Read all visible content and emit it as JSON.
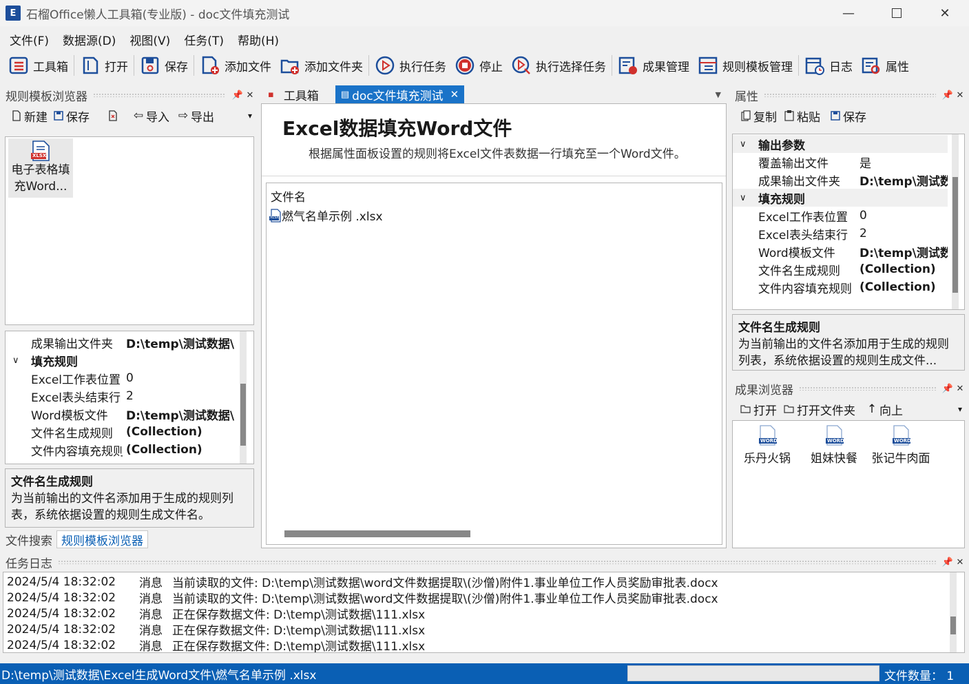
{
  "window": {
    "title": "石榴Office懒人工具箱(专业版) - doc文件填充测试",
    "app_icon": "E"
  },
  "menu": [
    "文件(F)",
    "数据源(D)",
    "视图(V)",
    "任务(T)",
    "帮助(H)"
  ],
  "toolbar": {
    "toolbox": "工具箱",
    "open": "打开",
    "save": "保存",
    "add_file": "添加文件",
    "add_folder": "添加文件夹",
    "run_task": "执行任务",
    "stop": "停止",
    "run_selected": "执行选择任务",
    "results": "成果管理",
    "rule_templates": "规则模板管理",
    "log": "日志",
    "properties": "属性"
  },
  "left_panel": {
    "title": "规则模板浏览器",
    "toolbar": {
      "new": "新建",
      "save": "保存",
      "import": "导入",
      "export": "导出"
    },
    "template_item": {
      "line1": "电子表格填",
      "line2": "充Word...",
      "badge": "XLSX"
    },
    "props": [
      {
        "key": "成果输出文件夹",
        "value": "D:\\temp\\测试数据\\"
      },
      {
        "key": "填充规则",
        "value": ""
      },
      {
        "key": "Excel工作表位置",
        "value": "0"
      },
      {
        "key": "Excel表头结束行",
        "value": "2"
      },
      {
        "key": "Word模板文件",
        "value": "D:\\temp\\测试数据\\"
      },
      {
        "key": "文件名生成规则",
        "value": "(Collection)"
      },
      {
        "key": "文件内容填充规则",
        "value": "(Collection)"
      }
    ],
    "desc_title": "文件名生成规则",
    "desc_text": "为当前输出的文件名添加用于生成的规则列表，系统依据设置的规则生成文件名。",
    "tabs": [
      "文件搜索",
      "规则模板浏览器"
    ]
  },
  "center": {
    "tabs": [
      "工具箱",
      "doc文件填充测试"
    ],
    "heading": "Excel数据填充Word文件",
    "subheading": "根据属性面板设置的规则将Excel文件表数据一行填充至一个Word文件。",
    "list_header": "文件名",
    "files": [
      {
        "name": "燃气名单示例 .xlsx",
        "badge": "XLSX"
      }
    ]
  },
  "right_props": {
    "title": "属性",
    "toolbar": {
      "copy": "复制",
      "paste": "粘贴",
      "save": "保存"
    },
    "groups": [
      {
        "name": "输出参数",
        "rows": [
          {
            "key": "覆盖输出文件",
            "value": "是"
          },
          {
            "key": "成果输出文件夹",
            "value": "D:\\temp\\测试数据"
          }
        ]
      },
      {
        "name": "填充规则",
        "rows": [
          {
            "key": "Excel工作表位置",
            "value": "0"
          },
          {
            "key": "Excel表头结束行",
            "value": "2"
          },
          {
            "key": "Word模板文件",
            "value": "D:\\temp\\测试数据"
          },
          {
            "key": "文件名生成规则",
            "value": "(Collection)"
          },
          {
            "key": "文件内容填充规则",
            "value": "(Collection)"
          }
        ]
      }
    ],
    "desc_title": "文件名生成规则",
    "desc_text": "为当前输出的文件名添加用于生成的规则列表，系统依据设置的规则生成文件..."
  },
  "results": {
    "title": "成果浏览器",
    "toolbar": {
      "open": "打开",
      "open_folder": "打开文件夹",
      "up": "向上"
    },
    "badge": "WORD",
    "files": [
      "乐丹火锅",
      "姐妹快餐",
      "张记牛肉面"
    ]
  },
  "log": {
    "title": "任务日志",
    "lines": [
      {
        "time": "2024/5/4 18:32:02",
        "level": "消息",
        "text": "当前读取的文件:  D:\\temp\\测试数据\\word文件数据提取\\(沙僧)附件1.事业单位工作人员奖励审批表.docx"
      },
      {
        "time": "2024/5/4 18:32:02",
        "level": "消息",
        "text": "当前读取的文件:  D:\\temp\\测试数据\\word文件数据提取\\(沙僧)附件1.事业单位工作人员奖励审批表.docx"
      },
      {
        "time": "2024/5/4 18:32:02",
        "level": "消息",
        "text": "正在保存数据文件:  D:\\temp\\测试数据\\111.xlsx"
      },
      {
        "time": "2024/5/4 18:32:02",
        "level": "消息",
        "text": "正在保存数据文件:  D:\\temp\\测试数据\\111.xlsx"
      },
      {
        "time": "2024/5/4 18:32:02",
        "level": "消息",
        "text": "正在保存数据文件:  D:\\temp\\测试数据\\111.xlsx"
      }
    ]
  },
  "status": {
    "path": "D:\\temp\\测试数据\\Excel生成Word文件\\燃气名单示例 .xlsx",
    "count": "文件数量：  1"
  },
  "colors": {
    "accent": "#0a5fb4",
    "tab_active": "#1a73c8",
    "status_bar": "#0a5fb4",
    "red": "#d0312d"
  }
}
